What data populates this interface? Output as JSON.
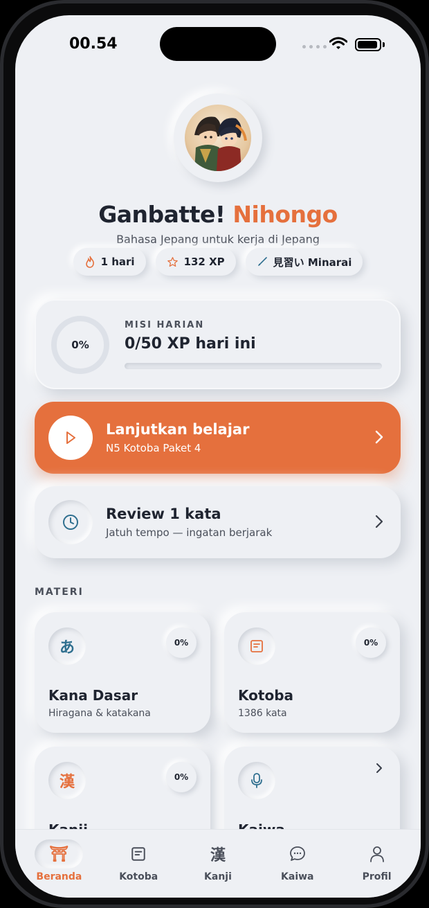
{
  "status_bar": {
    "time": "00.54"
  },
  "header": {
    "title_main": "Ganbatte!",
    "title_accent": "Nihongo",
    "subtitle": "Bahasa Jepang untuk kerja di Jepang",
    "avatar_icon": "anime-characters-avatar"
  },
  "stats": [
    {
      "icon": "flame-icon",
      "label": "1 hari"
    },
    {
      "icon": "star-icon",
      "label": "132 XP"
    },
    {
      "icon": "brush-icon",
      "label": "見習い Minarai"
    }
  ],
  "mission": {
    "percent_label": "0%",
    "progress": 0,
    "label": "MISI HARIAN",
    "value": "0/50 XP hari ini"
  },
  "continue": {
    "title": "Lanjutkan belajar",
    "subtitle": "N5 Kotoba Paket 4",
    "icon": "play-icon"
  },
  "review": {
    "title": "Review 1 kata",
    "subtitle": "Jatuh tempo — ingatan berjarak",
    "icon": "clock-icon"
  },
  "materi": {
    "section_label": "MATERI",
    "tiles": [
      {
        "glyph": "あ",
        "percent": "0%",
        "title": "Kana Dasar",
        "subtitle": "Hiragana & katakana"
      },
      {
        "glyph": "",
        "percent": "0%",
        "title": "Kotoba",
        "subtitle": "1386 kata"
      },
      {
        "glyph": "漢",
        "percent": "0%",
        "title": "Kanji",
        "subtitle": ""
      },
      {
        "glyph": "",
        "percent": "",
        "title": "Kaiwa",
        "subtitle": ""
      }
    ]
  },
  "nav": {
    "items": [
      {
        "label": "Beranda",
        "glyph": "⛩",
        "active": true
      },
      {
        "label": "Kotoba",
        "glyph": "",
        "active": false
      },
      {
        "label": "Kanji",
        "glyph": "漢",
        "active": false
      },
      {
        "label": "Kaiwa",
        "glyph": "",
        "active": false
      },
      {
        "label": "Profil",
        "glyph": "",
        "active": false
      }
    ]
  },
  "colors": {
    "accent": "#e5703d",
    "background": "#eef0f4",
    "text": "#1f2430",
    "teal": "#2f6f8f"
  }
}
